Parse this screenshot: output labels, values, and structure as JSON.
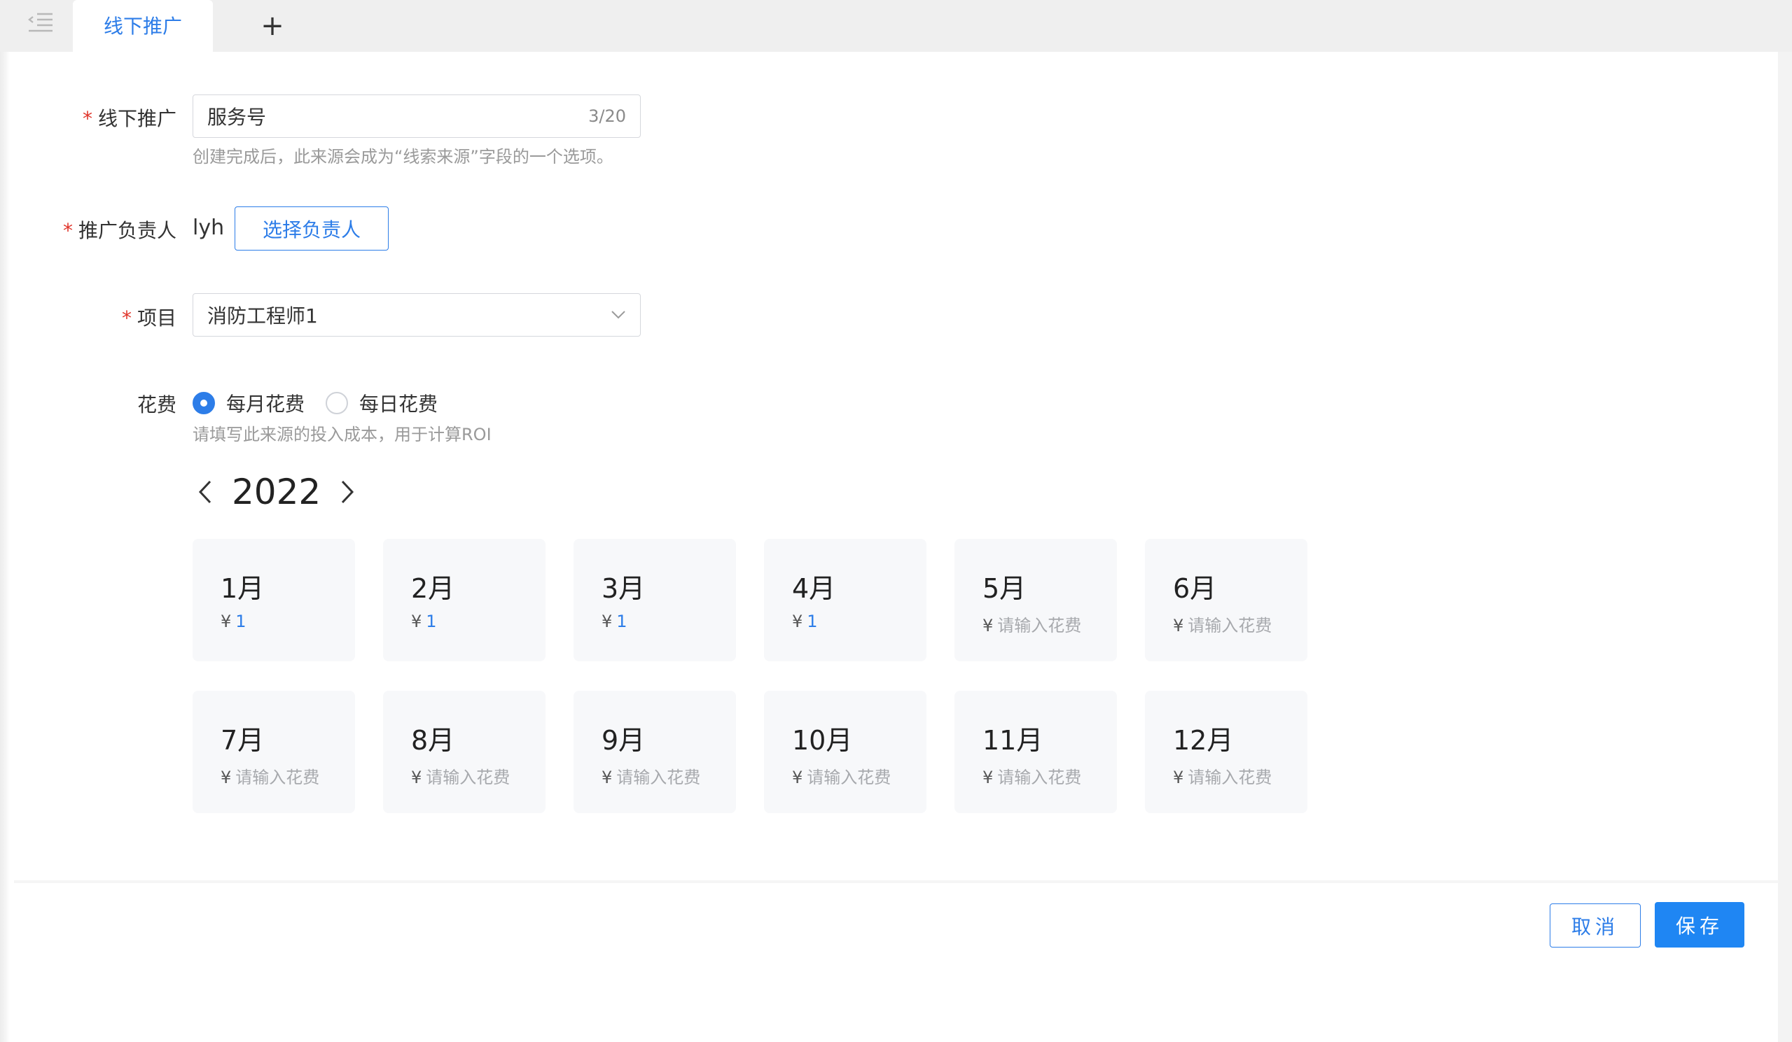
{
  "tabs": [
    {
      "label": "线下推广"
    }
  ],
  "add_tab_label": "+",
  "form": {
    "source": {
      "label": "线下推广",
      "required_mark": "*",
      "value": "服务号",
      "counter": "3/20",
      "hint": "创建完成后，此来源会成为“线索来源”字段的一个选项。"
    },
    "owner": {
      "label": "推广负责人",
      "required_mark": "*",
      "value": "lyh",
      "button_label": "选择负责人"
    },
    "project": {
      "label": "项目",
      "required_mark": "*",
      "value": "消防工程师1"
    },
    "cost": {
      "label": "花费",
      "options": [
        {
          "label": "每月花费",
          "checked": true
        },
        {
          "label": "每日花费",
          "checked": false
        }
      ],
      "hint": "请填写此来源的投入成本，用于计算ROI"
    }
  },
  "calendar": {
    "year": "2022",
    "currency": "¥",
    "placeholder": "请输入花费",
    "months": [
      {
        "name": "1月",
        "amount": "1"
      },
      {
        "name": "2月",
        "amount": "1"
      },
      {
        "name": "3月",
        "amount": "1"
      },
      {
        "name": "4月",
        "amount": "1"
      },
      {
        "name": "5月",
        "amount": ""
      },
      {
        "name": "6月",
        "amount": ""
      },
      {
        "name": "7月",
        "amount": ""
      },
      {
        "name": "8月",
        "amount": ""
      },
      {
        "name": "9月",
        "amount": ""
      },
      {
        "name": "10月",
        "amount": ""
      },
      {
        "name": "11月",
        "amount": ""
      },
      {
        "name": "12月",
        "amount": ""
      }
    ]
  },
  "footer": {
    "cancel_label": "取消",
    "save_label": "保存"
  },
  "colors": {
    "primary": "#2d7de8",
    "save_bg": "#1f86f3",
    "required": "#e0352b"
  }
}
